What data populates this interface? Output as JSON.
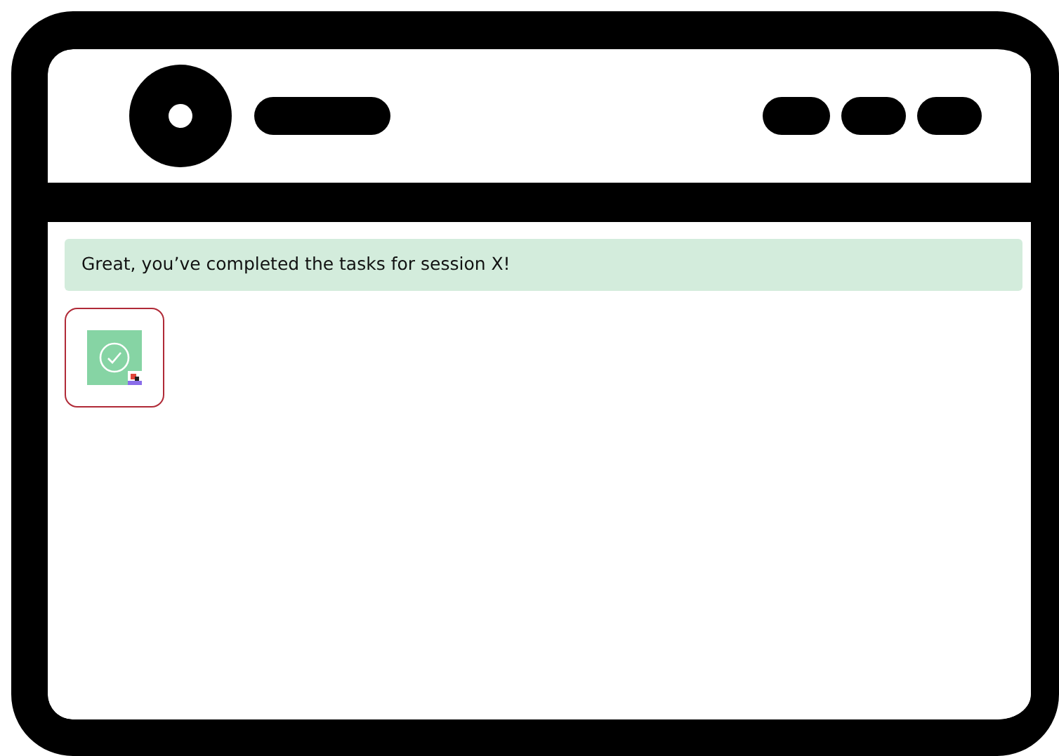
{
  "alert": {
    "text": "Great, you’ve completed the tasks for session X!"
  },
  "tasks": [
    {
      "completed": true,
      "selected": true
    }
  ]
}
